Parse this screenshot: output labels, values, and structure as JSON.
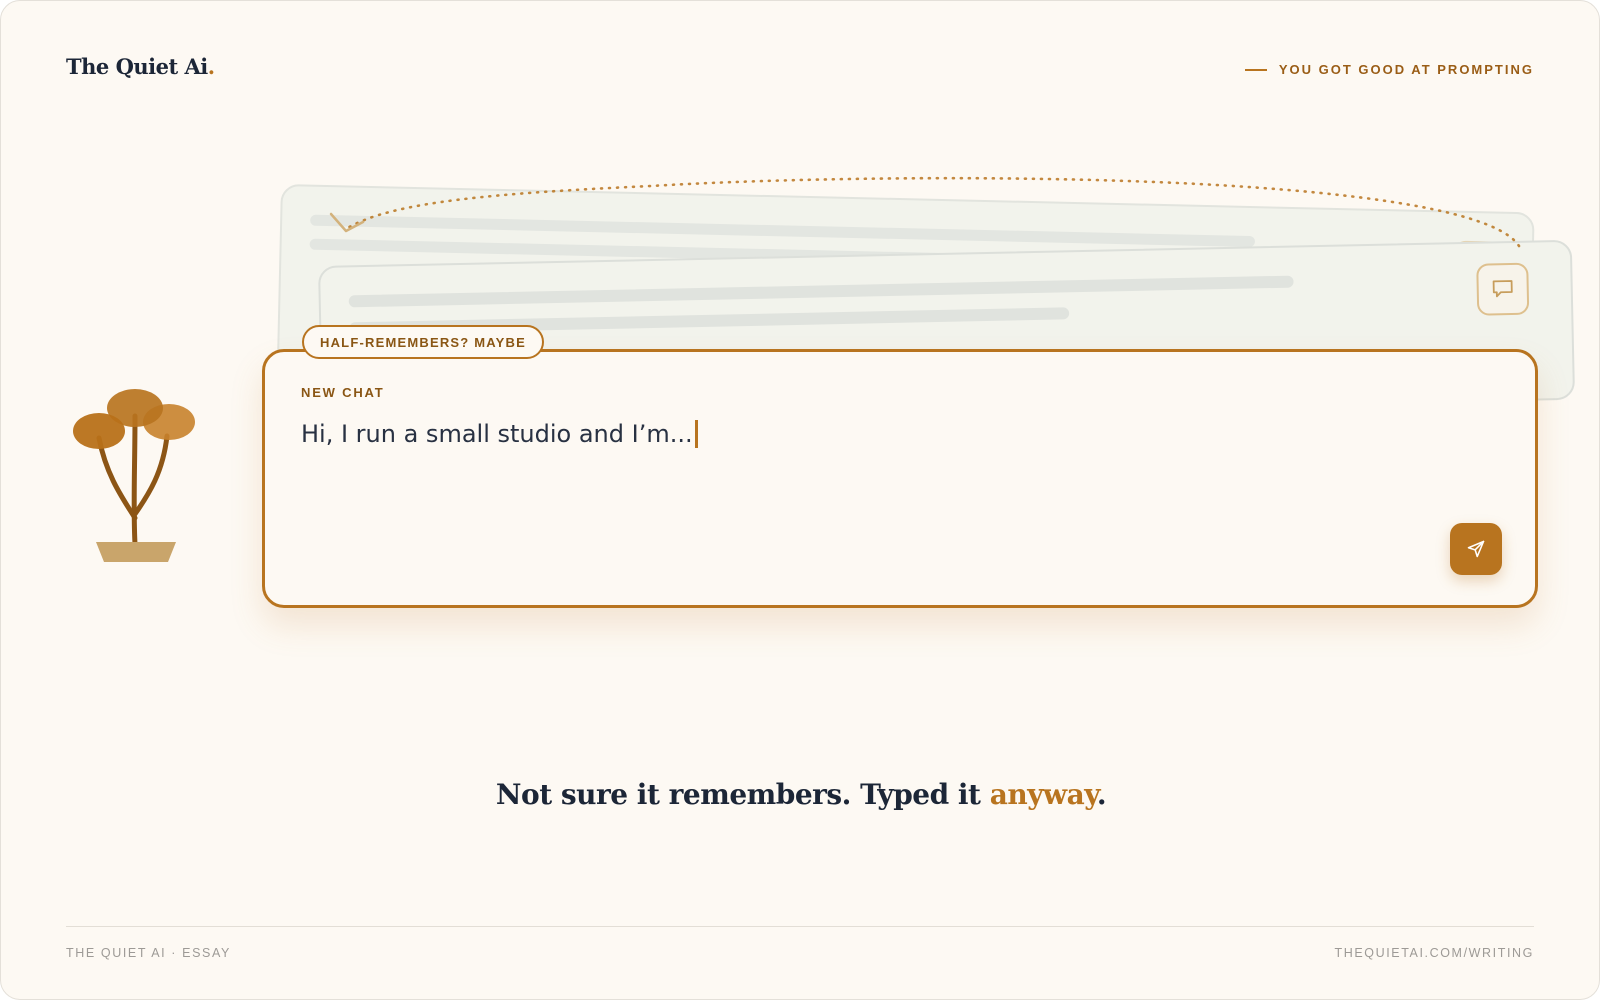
{
  "brand": {
    "name": "The Quiet Ai",
    "dot": "."
  },
  "tagline": "YOU GOT GOOD AT PROMPTING",
  "badge": "HALF-REMEMBERS? MAYBE",
  "chat": {
    "label": "NEW CHAT",
    "input_text": "Hi, I run a small studio and I’m..."
  },
  "headline": {
    "before": "Not sure it remembers. Typed it ",
    "accent": "anyway",
    "after": "."
  },
  "footer": {
    "left": "THE QUIET AI · ESSAY",
    "right": "THEQUIETAI.COM/WRITING"
  },
  "colors": {
    "accent": "#b8741f",
    "ink": "#1c2637",
    "background": "#fdf9f3"
  },
  "icons": {
    "send": "send-icon",
    "chat_bubble": "chat-bubble-icon",
    "plant": "plant-illustration"
  }
}
